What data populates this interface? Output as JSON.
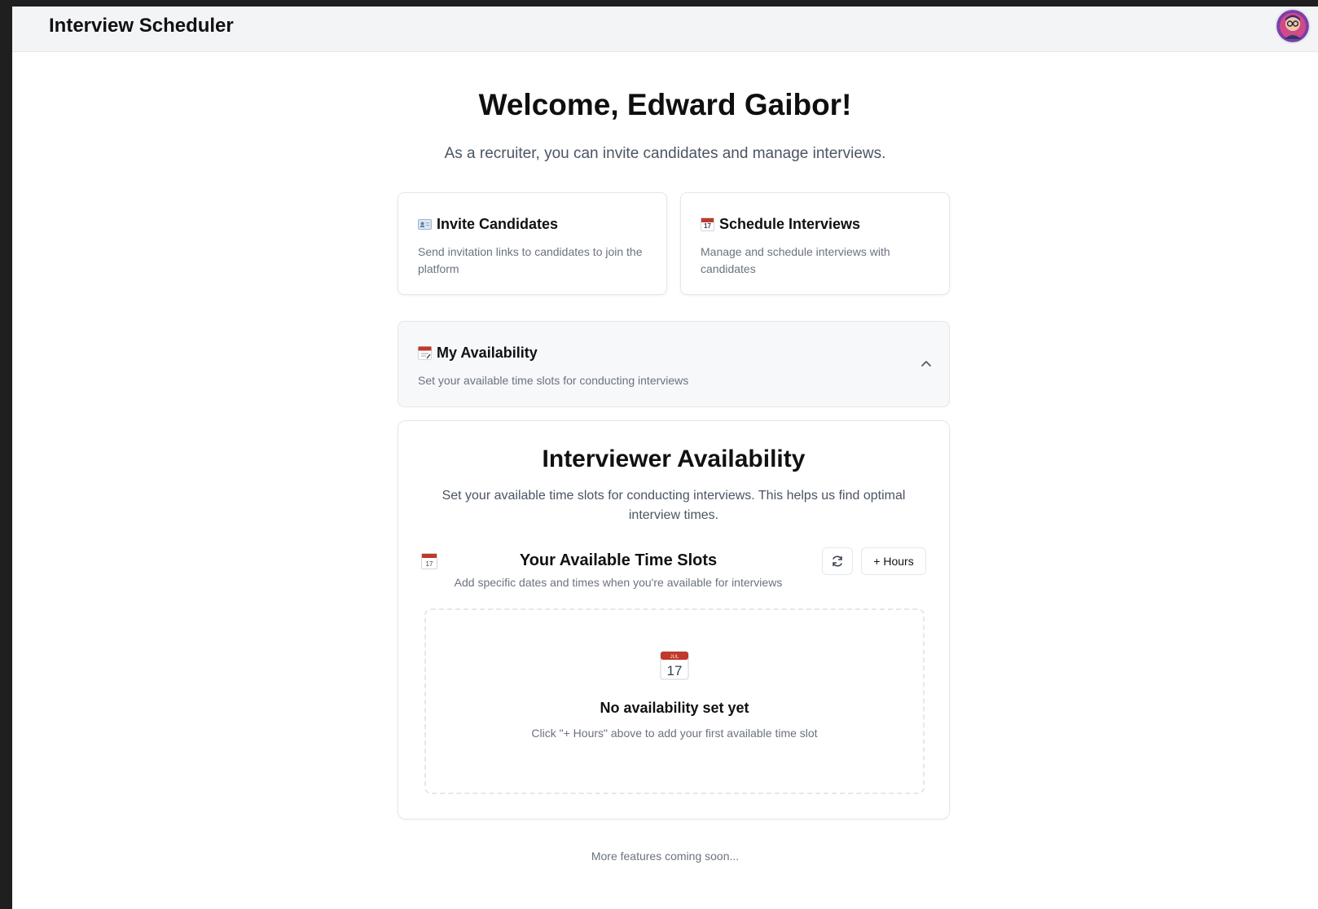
{
  "header": {
    "app_title": "Interview Scheduler",
    "avatar_icon": "user-avatar"
  },
  "welcome": {
    "title": "Welcome, Edward Gaibor!",
    "subtitle": "As a recruiter, you can invite candidates and manage interviews."
  },
  "cards": [
    {
      "title": "Invite Candidates",
      "description": "Send invitation links to candidates to join the platform",
      "icon": "id-card-icon"
    },
    {
      "title": "Schedule Interviews",
      "description": "Manage and schedule interviews with candidates",
      "icon": "calendar-icon"
    }
  ],
  "availability_panel": {
    "title": "My Availability",
    "description": "Set your available time slots for conducting interviews",
    "icon": "notepad-calendar-icon",
    "expanded": true
  },
  "interviewer_availability": {
    "title": "Interviewer Availability",
    "description": "Set your available time slots for conducting interviews. This helps us find optimal interview times.",
    "slots": {
      "title": "Your Available Time Slots",
      "description": "Add specific dates and times when you're available for interviews",
      "icon_date": "17",
      "refresh_icon": "refresh-icon",
      "add_hours_label": "+ Hours"
    },
    "empty_state": {
      "icon_month": "JUL",
      "icon_date": "17",
      "title": "No availability set yet",
      "description": "Click \"+ Hours\" above to add your first available time slot"
    }
  },
  "footer": {
    "text": "More features coming soon..."
  },
  "colors": {
    "topbar_bg": "#f3f4f6",
    "page_bg": "#ffffff",
    "panel_bg": "#f6f8fa",
    "border": "#e5e7eb",
    "muted_text": "#6b7280",
    "calendar_red": "#c0392b"
  }
}
